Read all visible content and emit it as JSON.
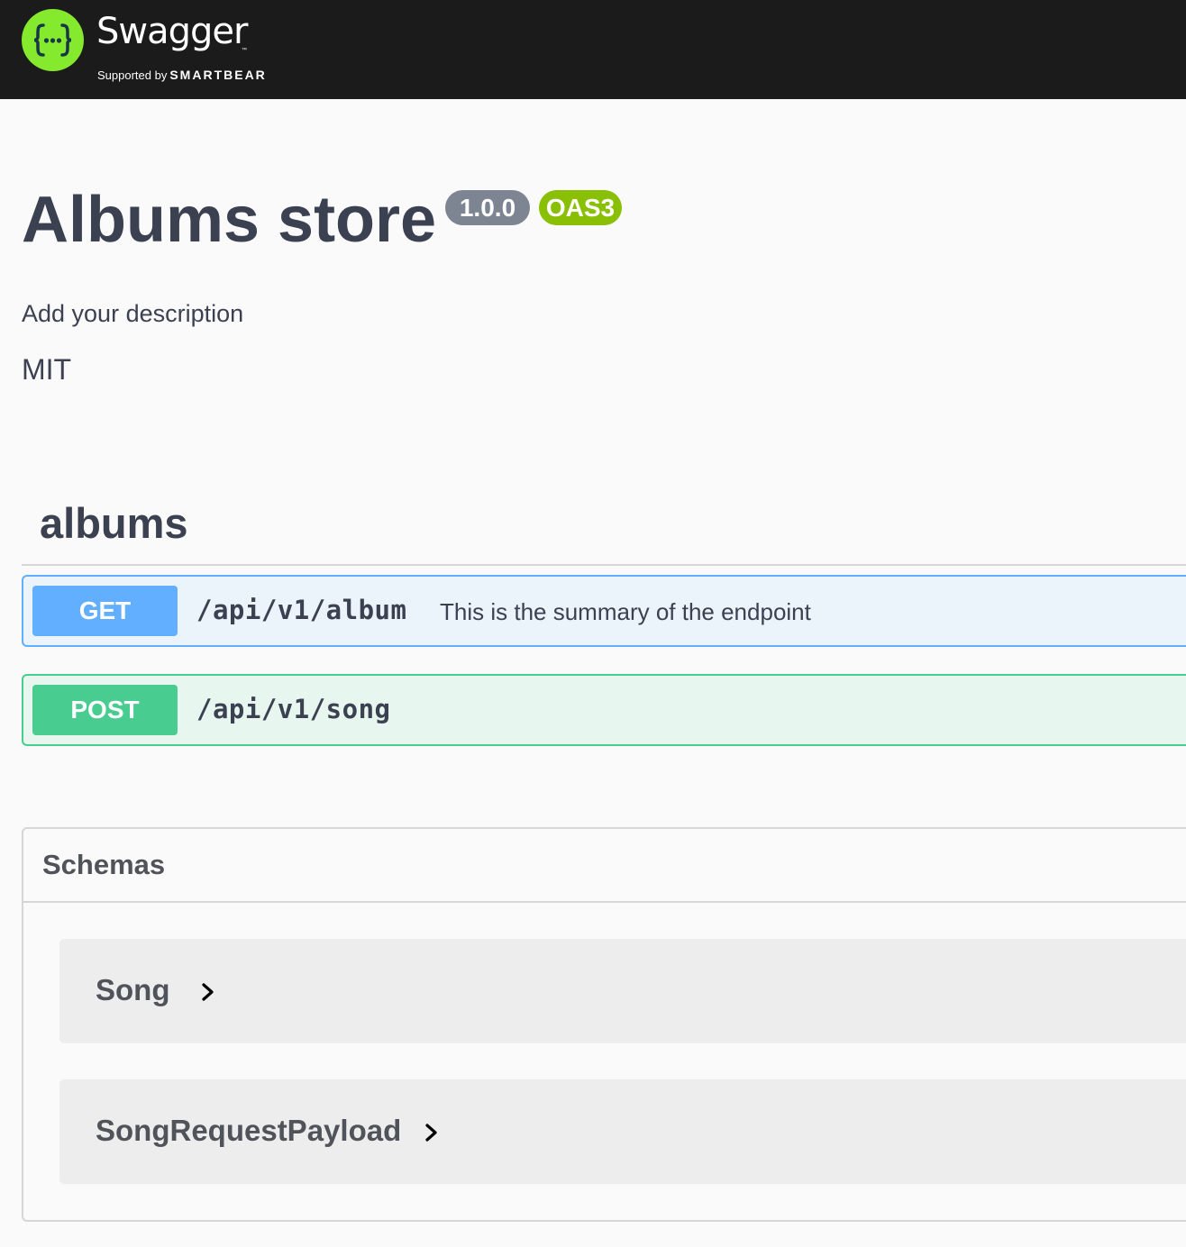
{
  "header": {
    "brand_name": "Swagger",
    "trademark": "™",
    "supported_by": "Supported by",
    "company": "SMARTBEAR",
    "logo_icon": "swagger-braces-icon",
    "logo_color": "#85ea2d",
    "bar_color": "#1b1b1b"
  },
  "info": {
    "title": "Albums store",
    "version": "1.0.0",
    "oas_badge": "OAS3",
    "description": "Add your description",
    "license": "MIT"
  },
  "tag": {
    "name": "albums",
    "operations": [
      {
        "method": "GET",
        "path": "/api/v1/album",
        "summary": "This is the summary of the endpoint",
        "color": "#61affe"
      },
      {
        "method": "POST",
        "path": "/api/v1/song",
        "summary": "",
        "color": "#49cc90"
      }
    ]
  },
  "schemas": {
    "title": "Schemas",
    "models": [
      {
        "name": "Song",
        "icon": "chevron-right-icon"
      },
      {
        "name": "SongRequestPayload",
        "icon": "chevron-right-icon"
      }
    ]
  }
}
